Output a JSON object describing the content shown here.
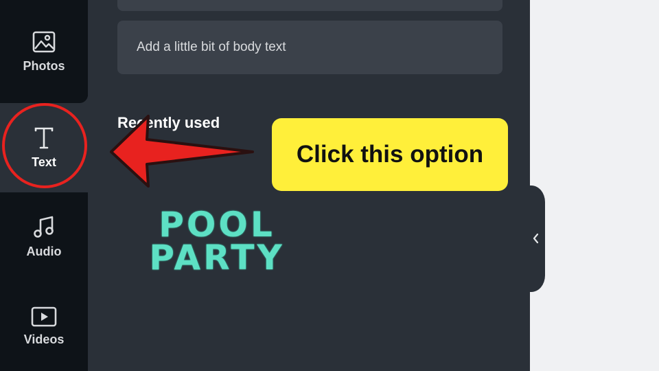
{
  "sidebar": {
    "items": [
      {
        "label": "Photos",
        "icon": "image-icon"
      },
      {
        "label": "Text",
        "icon": "text-t-icon"
      },
      {
        "label": "Audio",
        "icon": "music-note-icon"
      },
      {
        "label": "Videos",
        "icon": "video-play-icon"
      }
    ]
  },
  "panel": {
    "body_text_option": "Add a little bit of body text",
    "section_title": "Recently used",
    "recent_template": {
      "line1": "POOL",
      "line2": "PARTY"
    }
  },
  "annotation": {
    "callout_text": "Click this option",
    "color_highlight": "#ffef3a",
    "color_arrow": "#e8221f"
  },
  "colors": {
    "rail_bg": "#0e1318",
    "panel_bg": "#2a3038",
    "card_bg": "#3b414a",
    "accent_teal": "#5de0c4"
  }
}
